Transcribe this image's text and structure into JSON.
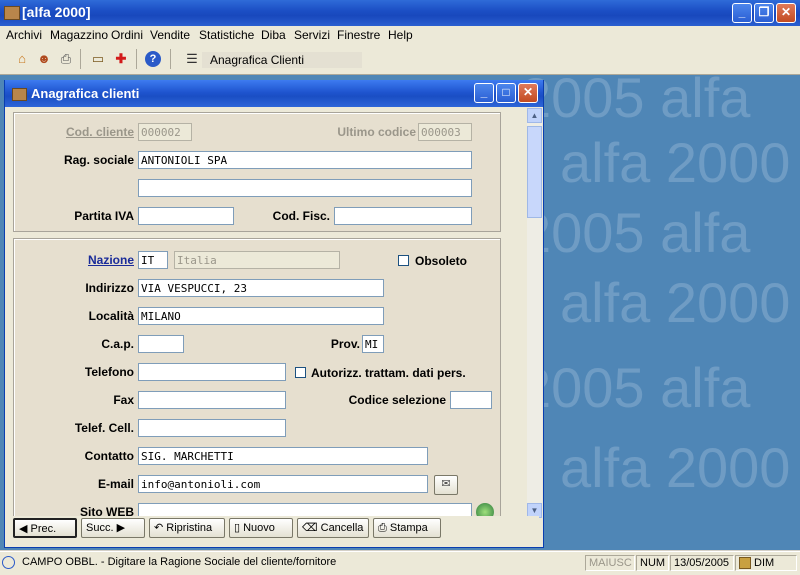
{
  "app": {
    "title": "[alfa 2000]"
  },
  "menu": [
    "Archivi",
    "Magazzino",
    "Ordini",
    "Vendite",
    "Statistiche",
    "Diba",
    "Servizi",
    "Finestre",
    "Help"
  ],
  "toolbar": {
    "window_label": "Anagrafica Clienti"
  },
  "window": {
    "title": "Anagrafica clienti"
  },
  "desktop_watermark": [
    "2005 alfa",
    "alfa 2000",
    "2005 alfa",
    "alfa 2000",
    "2005 alfa",
    "alfa 2000"
  ],
  "form": {
    "cod_cliente": {
      "label": "Cod. cliente",
      "value": "000002"
    },
    "ultimo_codice": {
      "label": "Ultimo codice",
      "value": "000003"
    },
    "rag_sociale": {
      "label": "Rag. sociale",
      "value": "ANTONIOLI SPA",
      "value2": ""
    },
    "partita_iva": {
      "label": "Partita IVA",
      "value": ""
    },
    "cod_fisc": {
      "label": "Cod. Fisc.",
      "value": ""
    },
    "nazione": {
      "label": "Nazione",
      "code": "IT",
      "name": "Italia"
    },
    "obsoleto": {
      "label": "Obsoleto",
      "checked": false
    },
    "indirizzo": {
      "label": "Indirizzo",
      "value": "VIA VESPUCCI, 23"
    },
    "localita": {
      "label": "Località",
      "value": "MILANO"
    },
    "cap": {
      "label": "C.a.p.",
      "value": ""
    },
    "prov": {
      "label": "Prov.",
      "value": "MI"
    },
    "telefono": {
      "label": "Telefono",
      "value": ""
    },
    "autorizz": {
      "label": "Autorizz. trattam. dati pers.",
      "checked": false
    },
    "fax": {
      "label": "Fax",
      "value": ""
    },
    "codice_selezione": {
      "label": "Codice selezione",
      "value": ""
    },
    "telef_cell": {
      "label": "Telef. Cell.",
      "value": ""
    },
    "contatto": {
      "label": "Contatto",
      "value": "SIG. MARCHETTI"
    },
    "email": {
      "label": "E-mail",
      "value": "info@antonioli.com"
    },
    "sito_web": {
      "label": "Sito WEB",
      "value": ""
    }
  },
  "buttons": {
    "prec": "Prec.",
    "succ": "Succ.",
    "ripristina": "Ripristina",
    "nuovo": "Nuovo",
    "cancella": "Cancella",
    "stampa": "Stampa"
  },
  "status": {
    "message": "CAMPO OBBL. - Digitare la Ragione Sociale del cliente/fornitore",
    "maiusc": "MAIUSC",
    "num": "NUM",
    "date": "13/05/2005",
    "dim": "DIM"
  }
}
